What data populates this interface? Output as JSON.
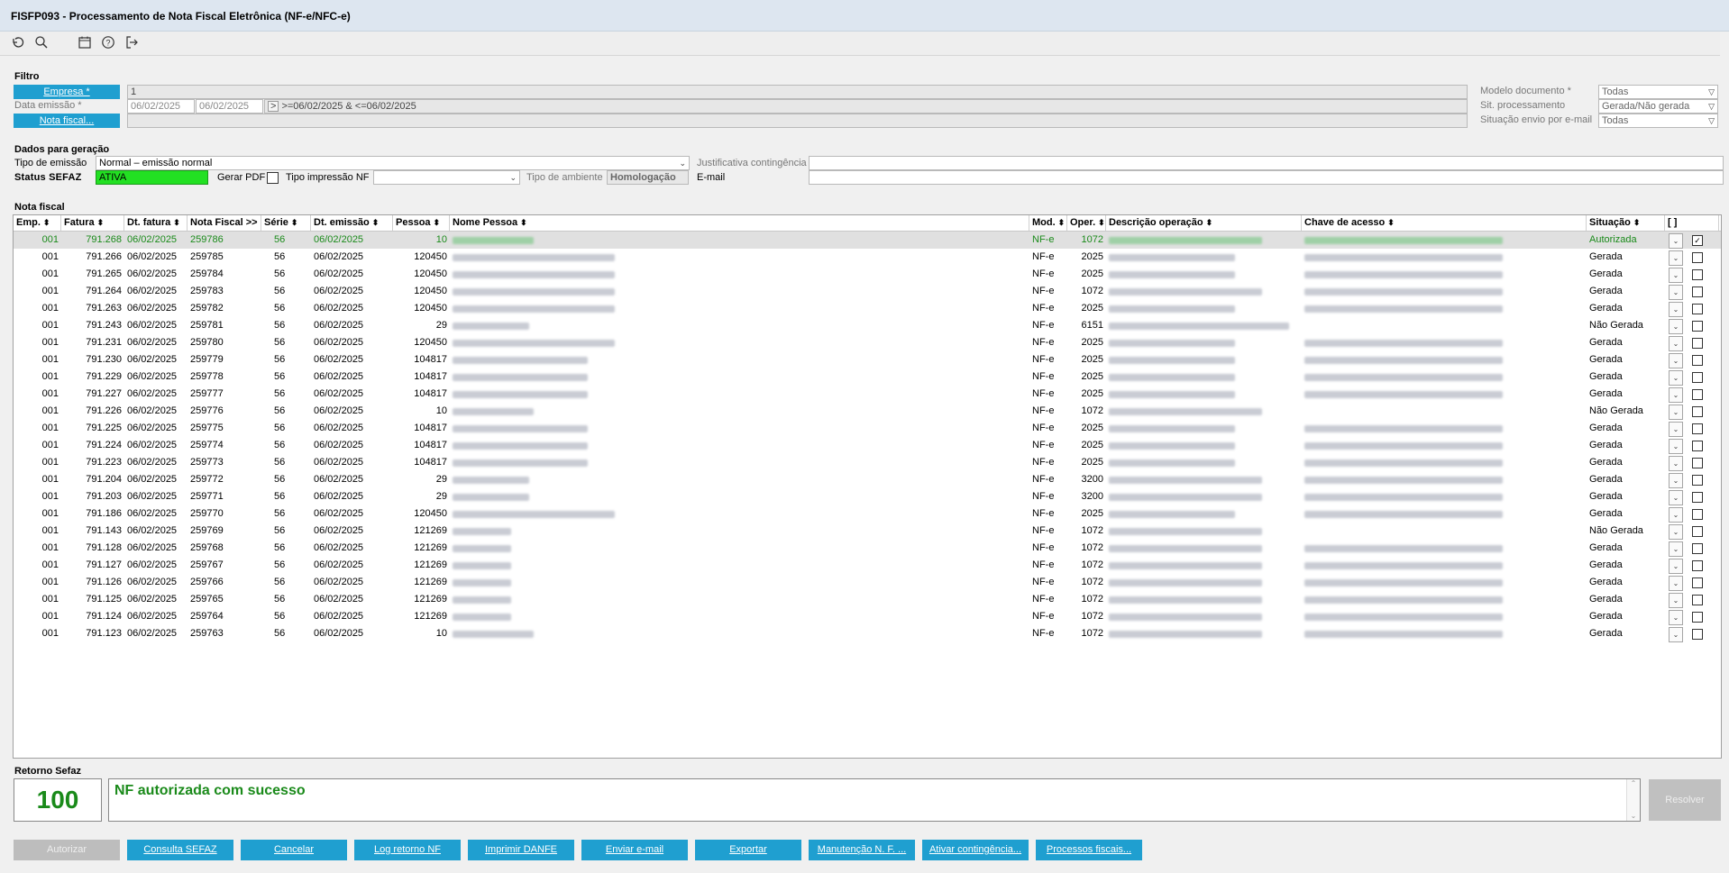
{
  "window": {
    "title": "FISFP093 - Processamento de Nota Fiscal Eletrônica (NF-e/NFC-e)"
  },
  "toolbar": {
    "icons": [
      "refresh-icon",
      "search-icon",
      "calendar-icon",
      "help-icon",
      "exit-icon"
    ]
  },
  "filtro": {
    "section_title": "Filtro",
    "empresa_label": "Empresa *",
    "empresa_value": "1",
    "data_emissao_label": "Data emissão *",
    "data_de": "06/02/2025",
    "data_ate": "06/02/2025",
    "data_expr_btn": ">",
    "data_expr": ">=06/02/2025 & <=06/02/2025",
    "nota_fiscal_label": "Nota fiscal...",
    "modelo_label": "Modelo documento *",
    "modelo_value": "Todas",
    "sit_label": "Sit. processamento",
    "sit_value": "Gerada/Não gerada",
    "envio_label": "Situação envio por e-mail",
    "envio_value": "Todas"
  },
  "dados": {
    "section_title": "Dados para geração",
    "tipo_emissao_label": "Tipo de emissão",
    "tipo_emissao_value": "Normal – emissão normal",
    "status_label": "Status SEFAZ",
    "status_value": "ATIVA",
    "gerar_pdf_label": "Gerar PDF",
    "tipo_impressao_label": "Tipo impressão NF",
    "tipo_impressao_value": "",
    "tipo_ambiente_label": "Tipo de ambiente",
    "tipo_ambiente_value": "Homologação",
    "justificativa_label": "Justificativa contingência",
    "email_label": "E-mail"
  },
  "grid": {
    "section_title": "Nota fiscal",
    "headers": [
      "Emp.",
      "Fatura",
      "Dt. fatura",
      "Nota Fiscal >>",
      "Série",
      "Dt. emissão",
      "Pessoa",
      "Nome Pessoa",
      "Mod.",
      "Oper.",
      "Descrição operação",
      "Chave de acesso",
      "Situação",
      "[ ]"
    ],
    "sort_arrow": "⬍",
    "rows": [
      {
        "emp": "001",
        "fatura": "791.268",
        "dt": "06/02/2025",
        "nf": "259786",
        "serie": "56",
        "emissao": "06/02/2025",
        "pessoa": "10",
        "mod": "NF-e",
        "oper": "1072",
        "sit": "Autorizada",
        "chk": true,
        "nome_w": 90,
        "desc_w": 170,
        "chave_w": 220
      },
      {
        "emp": "001",
        "fatura": "791.266",
        "dt": "06/02/2025",
        "nf": "259785",
        "serie": "56",
        "emissao": "06/02/2025",
        "pessoa": "120450",
        "mod": "NF-e",
        "oper": "2025",
        "sit": "Gerada",
        "chk": false,
        "nome_w": 180,
        "desc_w": 140,
        "chave_w": 220
      },
      {
        "emp": "001",
        "fatura": "791.265",
        "dt": "06/02/2025",
        "nf": "259784",
        "serie": "56",
        "emissao": "06/02/2025",
        "pessoa": "120450",
        "mod": "NF-e",
        "oper": "2025",
        "sit": "Gerada",
        "chk": false,
        "nome_w": 180,
        "desc_w": 140,
        "chave_w": 220
      },
      {
        "emp": "001",
        "fatura": "791.264",
        "dt": "06/02/2025",
        "nf": "259783",
        "serie": "56",
        "emissao": "06/02/2025",
        "pessoa": "120450",
        "mod": "NF-e",
        "oper": "1072",
        "sit": "Gerada",
        "chk": false,
        "nome_w": 180,
        "desc_w": 170,
        "chave_w": 220
      },
      {
        "emp": "001",
        "fatura": "791.263",
        "dt": "06/02/2025",
        "nf": "259782",
        "serie": "56",
        "emissao": "06/02/2025",
        "pessoa": "120450",
        "mod": "NF-e",
        "oper": "2025",
        "sit": "Gerada",
        "chk": false,
        "nome_w": 180,
        "desc_w": 140,
        "chave_w": 220
      },
      {
        "emp": "001",
        "fatura": "791.243",
        "dt": "06/02/2025",
        "nf": "259781",
        "serie": "56",
        "emissao": "06/02/2025",
        "pessoa": "29",
        "mod": "NF-e",
        "oper": "6151",
        "sit": "Não Gerada",
        "chk": false,
        "nome_w": 85,
        "desc_w": 200,
        "chave_w": 0
      },
      {
        "emp": "001",
        "fatura": "791.231",
        "dt": "06/02/2025",
        "nf": "259780",
        "serie": "56",
        "emissao": "06/02/2025",
        "pessoa": "120450",
        "mod": "NF-e",
        "oper": "2025",
        "sit": "Gerada",
        "chk": false,
        "nome_w": 180,
        "desc_w": 140,
        "chave_w": 220
      },
      {
        "emp": "001",
        "fatura": "791.230",
        "dt": "06/02/2025",
        "nf": "259779",
        "serie": "56",
        "emissao": "06/02/2025",
        "pessoa": "104817",
        "mod": "NF-e",
        "oper": "2025",
        "sit": "Gerada",
        "chk": false,
        "nome_w": 150,
        "desc_w": 140,
        "chave_w": 220
      },
      {
        "emp": "001",
        "fatura": "791.229",
        "dt": "06/02/2025",
        "nf": "259778",
        "serie": "56",
        "emissao": "06/02/2025",
        "pessoa": "104817",
        "mod": "NF-e",
        "oper": "2025",
        "sit": "Gerada",
        "chk": false,
        "nome_w": 150,
        "desc_w": 140,
        "chave_w": 220
      },
      {
        "emp": "001",
        "fatura": "791.227",
        "dt": "06/02/2025",
        "nf": "259777",
        "serie": "56",
        "emissao": "06/02/2025",
        "pessoa": "104817",
        "mod": "NF-e",
        "oper": "2025",
        "sit": "Gerada",
        "chk": false,
        "nome_w": 150,
        "desc_w": 140,
        "chave_w": 220
      },
      {
        "emp": "001",
        "fatura": "791.226",
        "dt": "06/02/2025",
        "nf": "259776",
        "serie": "56",
        "emissao": "06/02/2025",
        "pessoa": "10",
        "mod": "NF-e",
        "oper": "1072",
        "sit": "Não Gerada",
        "chk": false,
        "nome_w": 90,
        "desc_w": 170,
        "chave_w": 0
      },
      {
        "emp": "001",
        "fatura": "791.225",
        "dt": "06/02/2025",
        "nf": "259775",
        "serie": "56",
        "emissao": "06/02/2025",
        "pessoa": "104817",
        "mod": "NF-e",
        "oper": "2025",
        "sit": "Gerada",
        "chk": false,
        "nome_w": 150,
        "desc_w": 140,
        "chave_w": 220
      },
      {
        "emp": "001",
        "fatura": "791.224",
        "dt": "06/02/2025",
        "nf": "259774",
        "serie": "56",
        "emissao": "06/02/2025",
        "pessoa": "104817",
        "mod": "NF-e",
        "oper": "2025",
        "sit": "Gerada",
        "chk": false,
        "nome_w": 150,
        "desc_w": 140,
        "chave_w": 220
      },
      {
        "emp": "001",
        "fatura": "791.223",
        "dt": "06/02/2025",
        "nf": "259773",
        "serie": "56",
        "emissao": "06/02/2025",
        "pessoa": "104817",
        "mod": "NF-e",
        "oper": "2025",
        "sit": "Gerada",
        "chk": false,
        "nome_w": 150,
        "desc_w": 140,
        "chave_w": 220
      },
      {
        "emp": "001",
        "fatura": "791.204",
        "dt": "06/02/2025",
        "nf": "259772",
        "serie": "56",
        "emissao": "06/02/2025",
        "pessoa": "29",
        "mod": "NF-e",
        "oper": "3200",
        "sit": "Gerada",
        "chk": false,
        "nome_w": 85,
        "desc_w": 170,
        "chave_w": 220
      },
      {
        "emp": "001",
        "fatura": "791.203",
        "dt": "06/02/2025",
        "nf": "259771",
        "serie": "56",
        "emissao": "06/02/2025",
        "pessoa": "29",
        "mod": "NF-e",
        "oper": "3200",
        "sit": "Gerada",
        "chk": false,
        "nome_w": 85,
        "desc_w": 170,
        "chave_w": 220
      },
      {
        "emp": "001",
        "fatura": "791.186",
        "dt": "06/02/2025",
        "nf": "259770",
        "serie": "56",
        "emissao": "06/02/2025",
        "pessoa": "120450",
        "mod": "NF-e",
        "oper": "2025",
        "sit": "Gerada",
        "chk": false,
        "nome_w": 180,
        "desc_w": 140,
        "chave_w": 220
      },
      {
        "emp": "001",
        "fatura": "791.143",
        "dt": "06/02/2025",
        "nf": "259769",
        "serie": "56",
        "emissao": "06/02/2025",
        "pessoa": "121269",
        "mod": "NF-e",
        "oper": "1072",
        "sit": "Não Gerada",
        "chk": false,
        "nome_w": 65,
        "desc_w": 170,
        "chave_w": 0
      },
      {
        "emp": "001",
        "fatura": "791.128",
        "dt": "06/02/2025",
        "nf": "259768",
        "serie": "56",
        "emissao": "06/02/2025",
        "pessoa": "121269",
        "mod": "NF-e",
        "oper": "1072",
        "sit": "Gerada",
        "chk": false,
        "nome_w": 65,
        "desc_w": 170,
        "chave_w": 220
      },
      {
        "emp": "001",
        "fatura": "791.127",
        "dt": "06/02/2025",
        "nf": "259767",
        "serie": "56",
        "emissao": "06/02/2025",
        "pessoa": "121269",
        "mod": "NF-e",
        "oper": "1072",
        "sit": "Gerada",
        "chk": false,
        "nome_w": 65,
        "desc_w": 170,
        "chave_w": 220
      },
      {
        "emp": "001",
        "fatura": "791.126",
        "dt": "06/02/2025",
        "nf": "259766",
        "serie": "56",
        "emissao": "06/02/2025",
        "pessoa": "121269",
        "mod": "NF-e",
        "oper": "1072",
        "sit": "Gerada",
        "chk": false,
        "nome_w": 65,
        "desc_w": 170,
        "chave_w": 220
      },
      {
        "emp": "001",
        "fatura": "791.125",
        "dt": "06/02/2025",
        "nf": "259765",
        "serie": "56",
        "emissao": "06/02/2025",
        "pessoa": "121269",
        "mod": "NF-e",
        "oper": "1072",
        "sit": "Gerada",
        "chk": false,
        "nome_w": 65,
        "desc_w": 170,
        "chave_w": 220
      },
      {
        "emp": "001",
        "fatura": "791.124",
        "dt": "06/02/2025",
        "nf": "259764",
        "serie": "56",
        "emissao": "06/02/2025",
        "pessoa": "121269",
        "mod": "NF-e",
        "oper": "1072",
        "sit": "Gerada",
        "chk": false,
        "nome_w": 65,
        "desc_w": 170,
        "chave_w": 220
      },
      {
        "emp": "001",
        "fatura": "791.123",
        "dt": "06/02/2025",
        "nf": "259763",
        "serie": "56",
        "emissao": "06/02/2025",
        "pessoa": "10",
        "mod": "NF-e",
        "oper": "1072",
        "sit": "Gerada",
        "chk": false,
        "nome_w": 90,
        "desc_w": 170,
        "chave_w": 220
      }
    ]
  },
  "retorno": {
    "section_title": "Retorno Sefaz",
    "code": "100",
    "message": "NF autorizada com sucesso",
    "resolver_label": "Resolver"
  },
  "buttons": [
    "Autorizar",
    "Consulta SEFAZ",
    "Cancelar",
    "Log retorno NF",
    "Imprimir DANFE",
    "Enviar e-mail",
    "Exportar",
    "Manutenção N. F. ...",
    "Ativar contingência...",
    "Processos fiscais..."
  ],
  "colors": {
    "accent": "#1f9fd0",
    "status_ativa": "#22e022",
    "success_green": "#1a8a1a"
  }
}
